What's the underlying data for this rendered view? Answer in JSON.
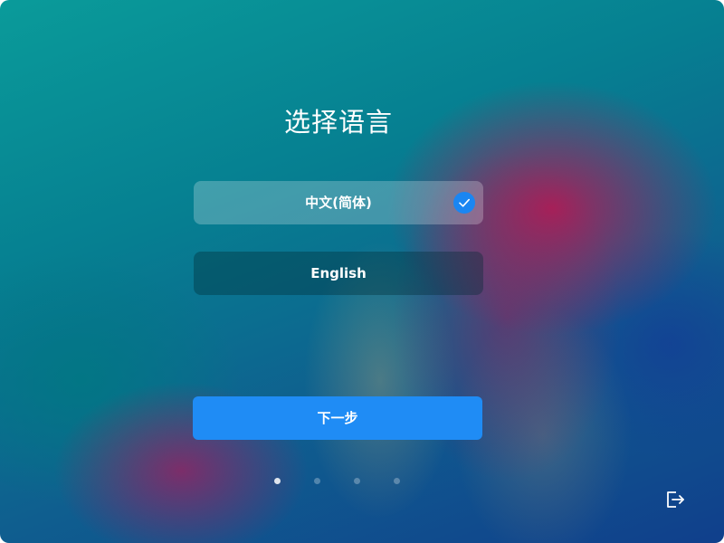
{
  "page": {
    "title": "选择语言"
  },
  "languages": [
    {
      "label": "中文(简体)",
      "selected": true
    },
    {
      "label": "English",
      "selected": false
    }
  ],
  "next_button": {
    "label": "下一步"
  },
  "pagination": {
    "total": 4,
    "current": 1
  },
  "icons": {
    "check": "check-icon",
    "exit": "exit-icon"
  },
  "colors": {
    "accent": "#1f8cf5"
  }
}
